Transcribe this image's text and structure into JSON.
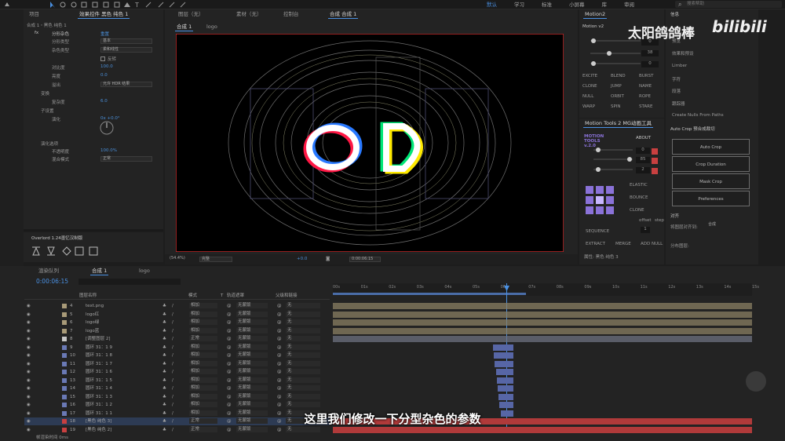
{
  "toolbar": {
    "workspaces": [
      "默认",
      "学习",
      "标准",
      "小屏幕",
      "库",
      "审阅"
    ],
    "search_placeholder": "搜索帮助"
  },
  "left_panel": {
    "tab_project": "项目",
    "tab_effects": "效果控件 黑色 纯色 1",
    "header": "合成 1・黑色 纯色 1",
    "fx_name": "分形杂色",
    "fx_reset": "重置",
    "params": [
      {
        "label": "分形类型",
        "value": "基本",
        "kind": "dd"
      },
      {
        "label": "杂色类型",
        "value": "柔和线性",
        "kind": "dd"
      },
      {
        "label": "",
        "value": "反转",
        "kind": "check"
      },
      {
        "label": "对比度",
        "value": "100.0",
        "kind": "num"
      },
      {
        "label": "亮度",
        "value": "0.0",
        "kind": "num"
      },
      {
        "label": "溢出",
        "value": "允许 HDR 结果",
        "kind": "dd"
      },
      {
        "label": "变换",
        "value": "",
        "kind": "group"
      },
      {
        "label": "复杂度",
        "value": "6.0",
        "kind": "num"
      },
      {
        "label": "子设置",
        "value": "",
        "kind": "group"
      },
      {
        "label": "演化",
        "value": "0x +0.0°",
        "kind": "num"
      }
    ],
    "params2": [
      {
        "label": "演化选项",
        "value": ""
      },
      {
        "label": "不透明度",
        "value": "100.0%"
      },
      {
        "label": "混合模式",
        "value": "正常"
      }
    ],
    "overlord": "Overlord 1.24墨忆汉制版"
  },
  "viewer": {
    "tabs": [
      "图层（无）",
      "素材（无）",
      "控制台",
      "合成 合成 1"
    ],
    "subtabs": [
      "合成 1",
      "logo"
    ],
    "zoom": "(54.4%)",
    "quality": "完整",
    "exposure": "+0.0",
    "timecode": "0:00:06:15"
  },
  "motion": {
    "title": "Motion2",
    "version": "Motion v2",
    "values": [
      "0",
      "38",
      "0"
    ],
    "buttons": [
      [
        "EXCITE",
        "BLEND",
        "BURST"
      ],
      [
        "CLONE",
        "JUMP",
        "NAME"
      ],
      [
        "NULL",
        "ORBIT",
        "ROPE"
      ],
      [
        "WARP",
        "SPIN",
        "STARE"
      ]
    ],
    "mt_title": "Motion Tools 2 MG动画工具",
    "mt_logo": "MOTION TOOLS v.2.0",
    "about": "ABOUT",
    "mt_values": [
      "0",
      "85",
      "2"
    ],
    "mt_labels": [
      "ELASTIC",
      "BOUNCE",
      "CLONE"
    ],
    "offset": "offset",
    "step": "step",
    "step_val": "1",
    "seq": "SEQUENCE",
    "extract": "EXTRACT",
    "merge": "MERGE",
    "addnull": "ADD NULL",
    "props": "属性: 黑色 纯色 3"
  },
  "right": {
    "info": "信息",
    "items": [
      "预览",
      "效果和预设",
      "Limber",
      "字符",
      "段落",
      "跟踪器",
      "Create Nulls From Paths"
    ],
    "autocrop": "Auto Crop 预合成裁切",
    "crop_buttons": [
      "Auto Crop",
      "Crop Duration",
      "Mask Crop",
      "Preferences"
    ],
    "align": "对齐",
    "align_to": "将图层对齐到:",
    "align_target": "合成",
    "distribute": "分布图层:"
  },
  "watermark": "太阳鸽鸽棒",
  "bili": "bilibili",
  "timeline": {
    "tabs": [
      "渲染队列",
      "合成 1",
      "logo"
    ],
    "timecode": "0:00:06:15",
    "cols": [
      "图层名称",
      "模式",
      "T",
      "轨道遮罩",
      "父级和链接"
    ],
    "ruler": [
      "00s",
      "01s",
      "02s",
      "03s",
      "04s",
      "05s",
      "06s",
      "07s",
      "08s",
      "09s",
      "10s",
      "11s",
      "12s",
      "13s",
      "14s",
      "15s"
    ],
    "layers": [
      {
        "n": "4",
        "name": "text.png",
        "mode": "相加",
        "tm": "无蒙版",
        "parent": "无",
        "c": "#a89a78"
      },
      {
        "n": "5",
        "name": "logo红",
        "mode": "相加",
        "tm": "无蒙版",
        "parent": "无",
        "c": "#a89a78"
      },
      {
        "n": "6",
        "name": "logo绿",
        "mode": "相加",
        "tm": "无蒙版",
        "parent": "无",
        "c": "#a89a78"
      },
      {
        "n": "7",
        "name": "logo蓝",
        "mode": "相加",
        "tm": "无蒙版",
        "parent": "无",
        "c": "#a89a78"
      },
      {
        "n": "8",
        "name": "[调整图层 2]",
        "mode": "正常",
        "tm": "无蒙版",
        "parent": "无",
        "c": "#c6c6c6"
      },
      {
        "n": "9",
        "name": "圆环 31：1 9",
        "mode": "相加",
        "tm": "无蒙版",
        "parent": "无",
        "c": "#6a79b5"
      },
      {
        "n": "10",
        "name": "圆环 31：1 8",
        "mode": "相加",
        "tm": "无蒙版",
        "parent": "无",
        "c": "#6a79b5"
      },
      {
        "n": "11",
        "name": "圆环 31：1 7",
        "mode": "相加",
        "tm": "无蒙版",
        "parent": "无",
        "c": "#6a79b5"
      },
      {
        "n": "12",
        "name": "圆环 31：1 6",
        "mode": "相加",
        "tm": "无蒙版",
        "parent": "无",
        "c": "#6a79b5"
      },
      {
        "n": "13",
        "name": "圆环 31：1 5",
        "mode": "相加",
        "tm": "无蒙版",
        "parent": "无",
        "c": "#6a79b5"
      },
      {
        "n": "14",
        "name": "圆环 31：1 4",
        "mode": "相加",
        "tm": "无蒙版",
        "parent": "无",
        "c": "#6a79b5"
      },
      {
        "n": "15",
        "name": "圆环 31：1 3",
        "mode": "相加",
        "tm": "无蒙版",
        "parent": "无",
        "c": "#6a79b5"
      },
      {
        "n": "16",
        "name": "圆环 31：1 2",
        "mode": "相加",
        "tm": "无蒙版",
        "parent": "无",
        "c": "#6a79b5"
      },
      {
        "n": "17",
        "name": "圆环 31：1 1",
        "mode": "相加",
        "tm": "无蒙版",
        "parent": "无",
        "c": "#6a79b5"
      },
      {
        "n": "18",
        "name": "[黑色 纯色 3]",
        "mode": "正常",
        "tm": "无蒙版",
        "parent": "无",
        "c": "#c84040"
      },
      {
        "n": "19",
        "name": "[黑色 纯色 2]",
        "mode": "正常",
        "tm": "无蒙版",
        "parent": "无",
        "c": "#c84040"
      }
    ],
    "footer": "帧渲染时间 0ms"
  },
  "subtitle": "这里我们修改一下分型杂色的参数",
  "colors": {
    "accent": "#4a90e2",
    "bar_tan": "#a89a78",
    "bar_blue": "#6a79b5",
    "bar_red": "#c84040"
  }
}
